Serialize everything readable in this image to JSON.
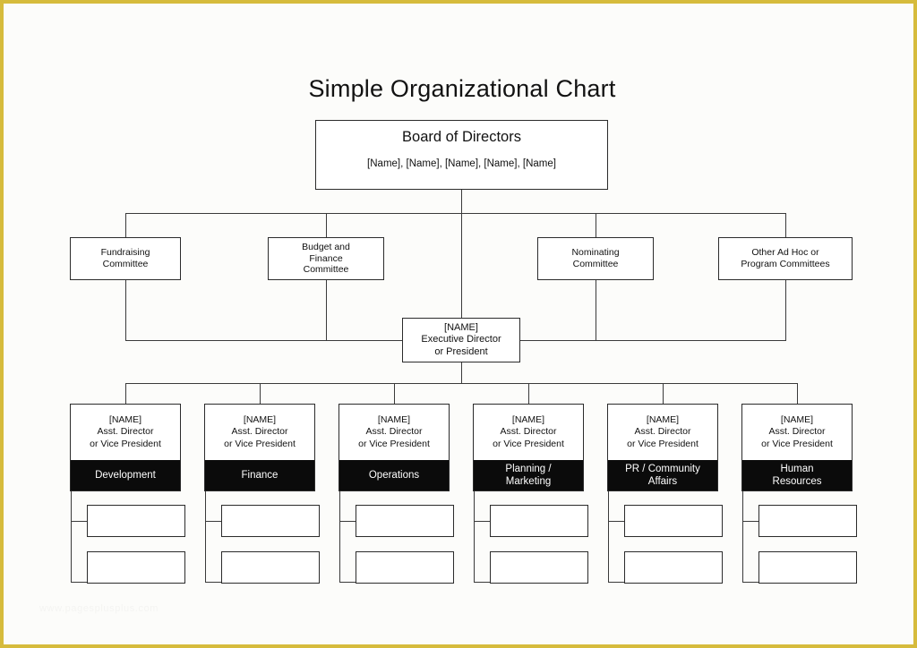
{
  "page": {
    "title": "Simple Organizational Chart",
    "border_color": "#d6bb3c",
    "background_color": "#fcfcfa",
    "line_color": "#3a3a3a",
    "band_color": "#0b0b0b",
    "watermark": "www.pagesplusplus.com"
  },
  "board": {
    "title": "Board of Directors",
    "names": "[Name], [Name], [Name], [Name], [Name]"
  },
  "committees": [
    {
      "lines": [
        "Fundraising",
        "Committee"
      ]
    },
    {
      "lines": [
        "Budget and",
        "Finance",
        "Committee"
      ]
    },
    {
      "lines": [
        "Nominating",
        "Committee"
      ]
    },
    {
      "lines": [
        "Other Ad Hoc or",
        "Program Committees"
      ]
    }
  ],
  "executive": {
    "lines": [
      "[NAME]",
      "Executive Director",
      "or President"
    ]
  },
  "departments": [
    {
      "person_lines": [
        "[NAME]",
        "Asst. Director",
        "or Vice President"
      ],
      "band_lines": [
        "Development"
      ],
      "sub_boxes": [
        "",
        ""
      ]
    },
    {
      "person_lines": [
        "[NAME]",
        "Asst. Director",
        "or Vice President"
      ],
      "band_lines": [
        "Finance"
      ],
      "sub_boxes": [
        "",
        ""
      ]
    },
    {
      "person_lines": [
        "[NAME]",
        "Asst. Director",
        "or Vice President"
      ],
      "band_lines": [
        "Operations"
      ],
      "sub_boxes": [
        "",
        ""
      ]
    },
    {
      "person_lines": [
        "[NAME]",
        "Asst. Director",
        "or Vice President"
      ],
      "band_lines": [
        "Planning /",
        "Marketing"
      ],
      "sub_boxes": [
        "",
        ""
      ]
    },
    {
      "person_lines": [
        "[NAME]",
        "Asst. Director",
        "or Vice President"
      ],
      "band_lines": [
        "PR / Community",
        "Affairs"
      ],
      "sub_boxes": [
        "",
        ""
      ]
    },
    {
      "person_lines": [
        "[NAME]",
        "Asst. Director",
        "or Vice President"
      ],
      "band_lines": [
        "Human",
        "Resources"
      ],
      "sub_boxes": [
        "",
        ""
      ]
    }
  ]
}
